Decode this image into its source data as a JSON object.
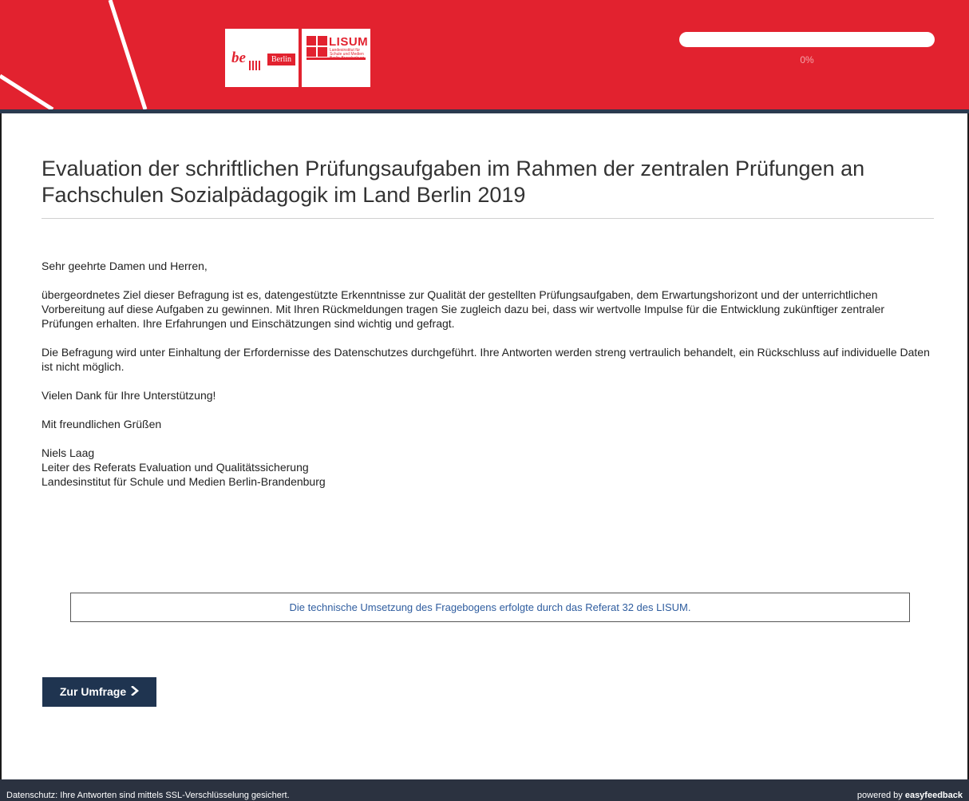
{
  "header": {
    "logo_be_text": "be",
    "logo_be_flag": "Berlin",
    "logo_lisum_title": "LISUM",
    "logo_lisum_sub": "Landesinstitut für Schule und Medien Berlin-Brandenburg",
    "brand_color": "#e2222f",
    "progress": {
      "percent": 0,
      "label": "0%"
    }
  },
  "main": {
    "title": "Evaluation der schriftlichen Prüfungsaufgaben im Rahmen der zentralen Prüfungen an Fachschulen Sozialpädagogik im Land Berlin 2019",
    "greeting": "Sehr geehrte Damen und Herren,",
    "paragraph1": "übergeordnetes Ziel dieser Befragung ist es, datengestützte Erkenntnisse zur Qualität der gestellten Prüfungsaufgaben, dem Erwartungshorizont und der unterrichtlichen Vorbereitung auf diese Aufgaben zu gewinnen. Mit Ihren Rückmeldungen tragen Sie zugleich dazu bei, dass wir wertvolle Impulse für die Entwicklung zukünftiger zentraler Prüfungen erhalten. Ihre Erfahrungen und Einschätzungen sind wichtig und gefragt.",
    "paragraph2": "Die Befragung wird unter Einhaltung der Erfordernisse des Datenschutzes durchgeführt. Ihre Antworten werden streng vertraulich behandelt, ein Rückschluss auf individuelle Daten ist nicht möglich.",
    "thanks": "Vielen Dank für Ihre Unterstützung!",
    "closing": "Mit freundlichen Grüßen",
    "signature": {
      "name": "Niels Laag",
      "role": "Leiter des Referats Evaluation und Qualitätssicherung",
      "institute": "Landesinstitut für Schule und Medien Berlin-Brandenburg"
    },
    "credit": "Die technische Umsetzung des Fragebogens erfolgte durch das Referat 32 des LISUM.",
    "cta_label": "Zur Umfrage",
    "cta_icon": "chevron-right-icon"
  },
  "footer": {
    "privacy": "Datenschutz: Ihre Antworten sind mittels SSL-Verschlüsselung gesichert.",
    "powered_prefix": "powered by ",
    "powered_brand": "easyfeedback"
  }
}
